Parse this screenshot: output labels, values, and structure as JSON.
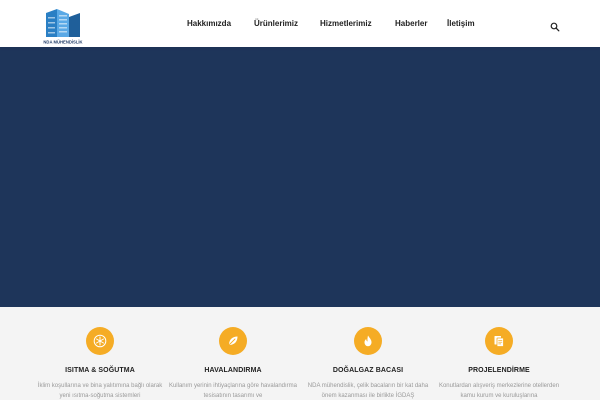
{
  "brand": {
    "logo_text": "NDA MÜHENDİSLİK",
    "accent": "#f5ac25",
    "hero_color": "#1e355a"
  },
  "nav": {
    "items": [
      {
        "label": "Hakkımızda"
      },
      {
        "label": "Ürünlerimiz"
      },
      {
        "label": "Hizmetlerimiz"
      },
      {
        "label": "Haberler"
      },
      {
        "label": "İletişim"
      }
    ],
    "search_icon": "search-icon"
  },
  "services": [
    {
      "icon": "snowflake-icon",
      "title": "ISITMA & SOĞUTMA",
      "desc": "İklim koşullarına ve bina yalıtımına bağlı olarak yeni ısıtma-soğutma sistemleri"
    },
    {
      "icon": "leaf-icon",
      "title": "HAVALANDIRMA",
      "desc": "Kullanım yerinin ihtiyaçlarına göre havalandırma tesisatının tasarımı ve"
    },
    {
      "icon": "flame-icon",
      "title": "DOĞALGAZ BACASI",
      "desc": "NDA mühendislik, çelik bacaların bir kat daha önem kazanması ile birlikte İGDAŞ"
    },
    {
      "icon": "documents-icon",
      "title": "PROJELENDİRME",
      "desc": "Konutlardan alışveriş merkezlerine otellerden kamu kurum ve kuruluşlarına"
    }
  ]
}
